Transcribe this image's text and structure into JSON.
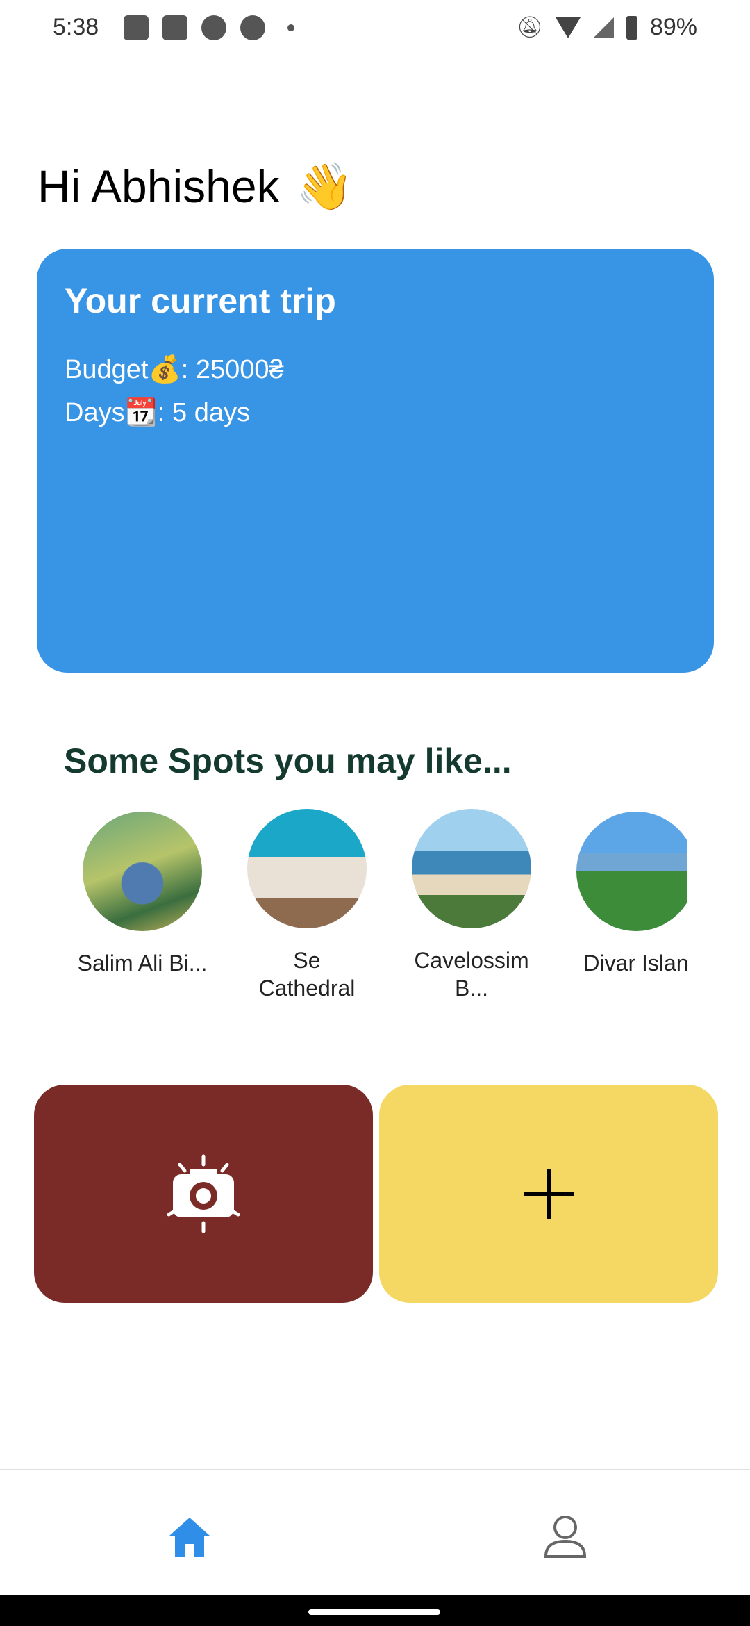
{
  "status_bar": {
    "time": "5:38",
    "battery": "89%"
  },
  "greeting": {
    "text": "Hi Abhishek",
    "emoji": "👋"
  },
  "trip_card": {
    "title": "Your current trip",
    "budget_line": "Budget💰: 25000₴",
    "days_line": "Days📆: 5 days",
    "color": "#3894e5"
  },
  "spots": {
    "title": "Some Spots you may like...",
    "items": [
      {
        "label": "Salim Ali Bi..."
      },
      {
        "label": "Se\nCathedral"
      },
      {
        "label": "Cavelossim\nB..."
      },
      {
        "label": "Divar Islan"
      }
    ]
  },
  "actions": {
    "camera_color": "#7a2b27",
    "add_color": "#f5d764",
    "camera_icon": "camera-icon",
    "add_icon": "plus-icon"
  },
  "bottom_nav": {
    "home_icon": "home-icon",
    "profile_icon": "person-icon",
    "active_color": "#2f8ee8"
  }
}
